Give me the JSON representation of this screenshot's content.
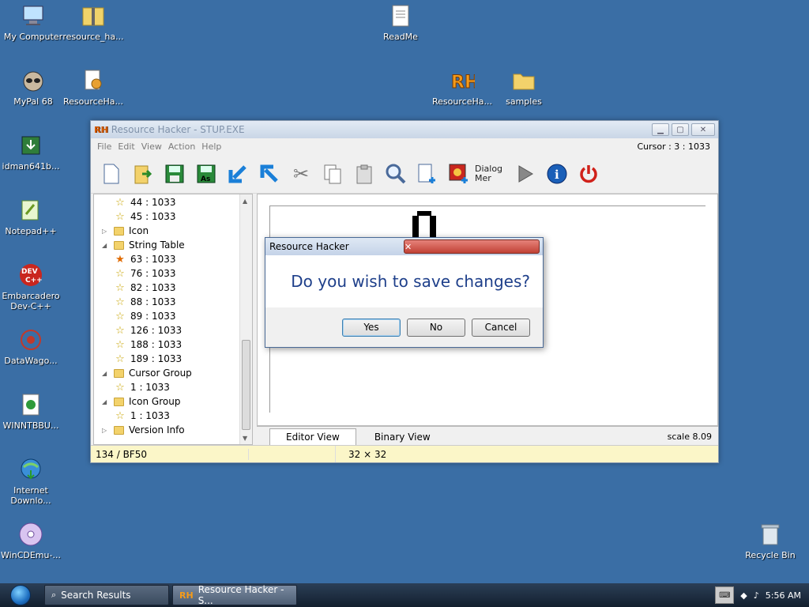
{
  "desktop": {
    "icons": [
      {
        "label": "My Computer"
      },
      {
        "label": "resource_ha..."
      },
      {
        "label": "ReadMe"
      },
      {
        "label": "MyPal 68"
      },
      {
        "label": "ResourceHa..."
      },
      {
        "label": "ResourceHa..."
      },
      {
        "label": "samples"
      },
      {
        "label": "idman641b..."
      },
      {
        "label": "Notepad++"
      },
      {
        "label": "Embarcadero Dev-C++"
      },
      {
        "label": "DataWago..."
      },
      {
        "label": "WINNTBBU..."
      },
      {
        "label": "Internet Downlo..."
      },
      {
        "label": "WinCDEmu-..."
      },
      {
        "label": "Recycle Bin"
      }
    ]
  },
  "window": {
    "title": "Resource Hacker - STUP.EXE",
    "menu": [
      "File",
      "Edit",
      "View",
      "Action",
      "Help"
    ],
    "cursor": "Cursor : 3 : 1033",
    "toolbar_dialog_label": "Dialog Mer",
    "tree": [
      {
        "label": "44 : 1033"
      },
      {
        "label": "45 : 1033"
      },
      {
        "label": "Icon"
      },
      {
        "label": "String Table"
      },
      {
        "label": "63 : 1033"
      },
      {
        "label": "76 : 1033"
      },
      {
        "label": "82 : 1033"
      },
      {
        "label": "88 : 1033"
      },
      {
        "label": "89 : 1033"
      },
      {
        "label": "126 : 1033"
      },
      {
        "label": "188 : 1033"
      },
      {
        "label": "189 : 1033"
      },
      {
        "label": "Cursor Group"
      },
      {
        "label": "1 : 1033"
      },
      {
        "label": "Icon Group"
      },
      {
        "label": "1 : 1033"
      },
      {
        "label": "Version Info"
      }
    ],
    "tabs": {
      "editor": "Editor View",
      "binary": "Binary View"
    },
    "scale": "scale 8.09",
    "status": {
      "left": "134 / BF50",
      "size": "32 × 32"
    }
  },
  "dialog": {
    "title": "Resource Hacker",
    "message": "Do you wish to save changes?",
    "yes": "Yes",
    "no": "No",
    "cancel": "Cancel"
  },
  "taskbar": {
    "tasks": [
      {
        "label": "Search Results"
      },
      {
        "label": "Resource Hacker - S..."
      }
    ],
    "clock": "5:56 AM"
  }
}
